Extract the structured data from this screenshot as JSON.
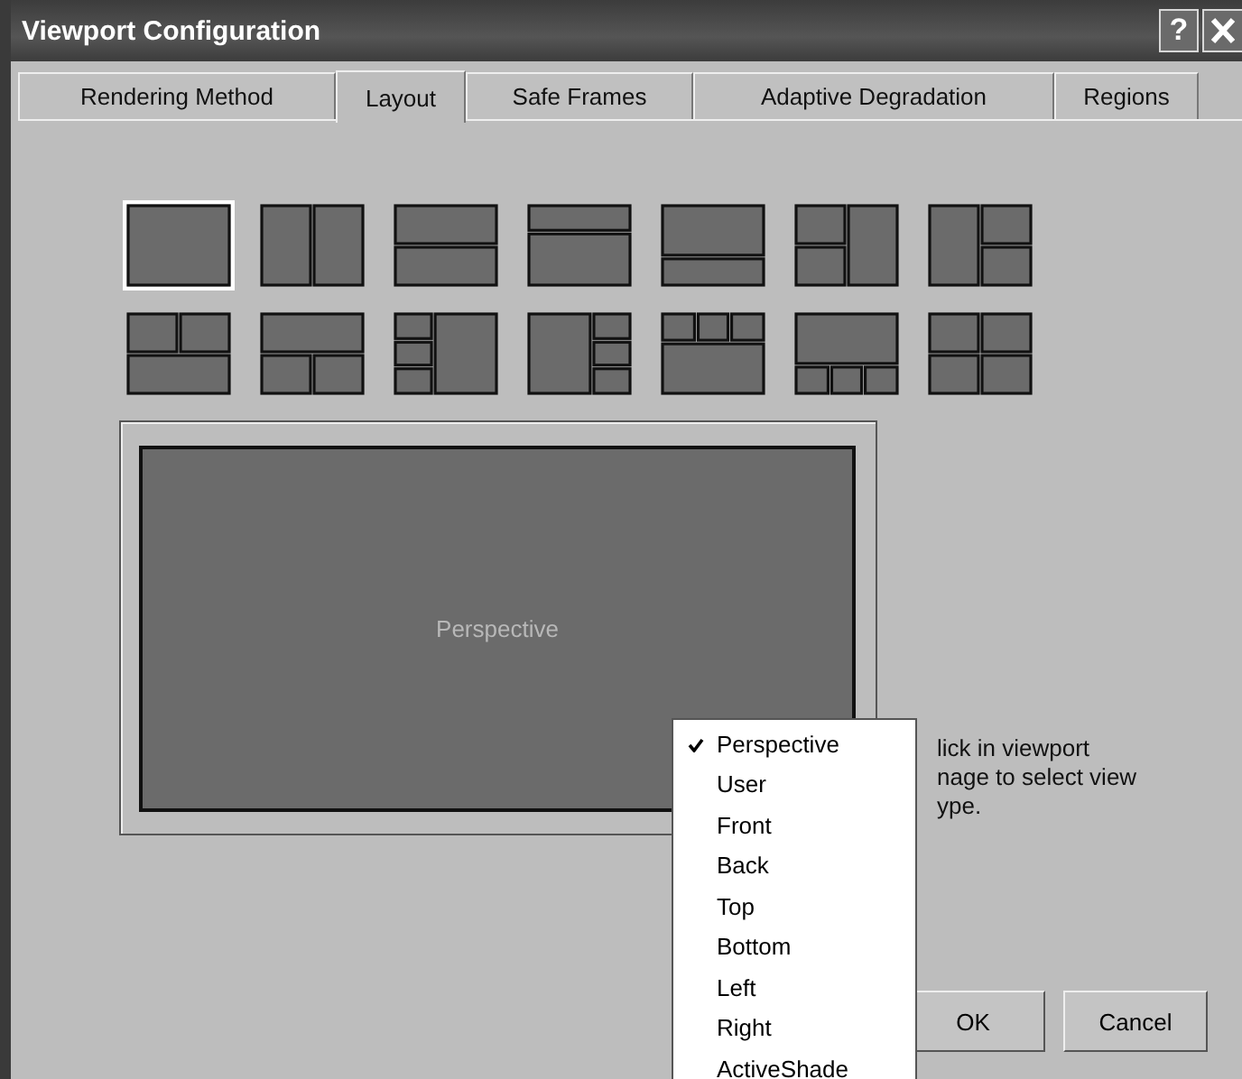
{
  "window": {
    "title": "Viewport Configuration",
    "help": "?"
  },
  "tabs": [
    {
      "label": "Rendering Method",
      "selected": false
    },
    {
      "label": "Layout",
      "selected": true
    },
    {
      "label": "Safe Frames",
      "selected": false
    },
    {
      "label": "Adaptive Degradation",
      "selected": false
    },
    {
      "label": "Regions",
      "selected": false
    }
  ],
  "layouts": [
    {
      "kind": "single",
      "selected": true
    },
    {
      "kind": "two-columns",
      "selected": false
    },
    {
      "kind": "two-rows",
      "selected": false
    },
    {
      "kind": "small-top",
      "selected": false
    },
    {
      "kind": "small-bottom",
      "selected": false
    },
    {
      "kind": "two-left-one-right",
      "selected": false
    },
    {
      "kind": "one-left-two-right",
      "selected": false
    },
    {
      "kind": "two-top-one-bottom",
      "selected": false
    },
    {
      "kind": "one-top-two-bottom",
      "selected": false
    },
    {
      "kind": "three-left-one-right",
      "selected": false
    },
    {
      "kind": "one-left-three-right",
      "selected": false
    },
    {
      "kind": "three-top-one-bottom",
      "selected": false
    },
    {
      "kind": "one-top-three-bottom",
      "selected": false
    },
    {
      "kind": "four",
      "selected": false
    }
  ],
  "preview": {
    "viewport_label": "Perspective"
  },
  "hint": [
    "lick in viewport",
    "nage to select view",
    "ype."
  ],
  "menu": [
    {
      "label": "Perspective",
      "checked": true
    },
    {
      "label": "User",
      "checked": false
    },
    {
      "label": "Front",
      "checked": false
    },
    {
      "label": "Back",
      "checked": false
    },
    {
      "label": "Top",
      "checked": false
    },
    {
      "label": "Bottom",
      "checked": false
    },
    {
      "label": "Left",
      "checked": false
    },
    {
      "label": "Right",
      "checked": false
    },
    {
      "label": "ActiveShade",
      "checked": false
    }
  ],
  "buttons": [
    "OK",
    "Cancel"
  ]
}
